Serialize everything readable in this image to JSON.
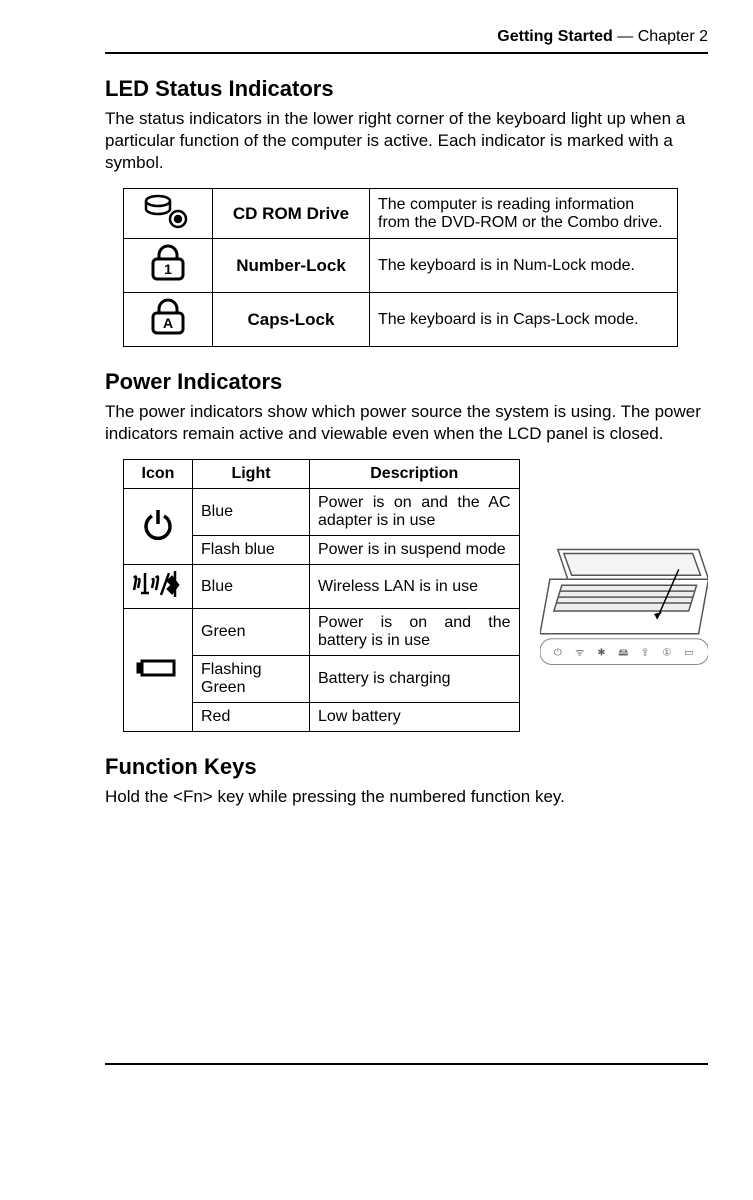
{
  "header": {
    "section": "Getting Started",
    "chapter": "— Chapter 2"
  },
  "sections": {
    "led": {
      "title": "LED Status Indicators",
      "intro": "The status indicators in the lower right corner of the keyboard light up when a particular function of the computer is active. Each indicator is marked with a symbol.",
      "rows": [
        {
          "name": "CD ROM Drive",
          "desc": "The computer is reading information from the DVD-ROM or the Combo drive."
        },
        {
          "name": "Number-Lock",
          "desc": "The keyboard is in Num-Lock mode."
        },
        {
          "name": "Caps-Lock",
          "desc": "The keyboard is in Caps-Lock mode."
        }
      ]
    },
    "power": {
      "title": "Power Indicators",
      "intro": "The power indicators show which power source the system is using. The power indicators remain active and viewable even when the LCD panel is closed.",
      "headers": {
        "icon": "Icon",
        "light": "Light",
        "desc": "Description"
      },
      "rows": [
        {
          "light": "Blue",
          "desc": "Power is on and the AC adapter is in use"
        },
        {
          "light": "Flash blue",
          "desc": "Power is in suspend mode"
        },
        {
          "light": "Blue",
          "desc": "Wireless LAN is in use"
        },
        {
          "light": "Green",
          "desc": "Power is on and the battery is in use"
        },
        {
          "light": "Flashing Green",
          "desc": "Battery is charging"
        },
        {
          "light": "Red",
          "desc": "Low battery"
        }
      ]
    },
    "fn": {
      "title": "Function Keys",
      "intro": "Hold the <Fn> key while pressing the numbered function key."
    }
  }
}
